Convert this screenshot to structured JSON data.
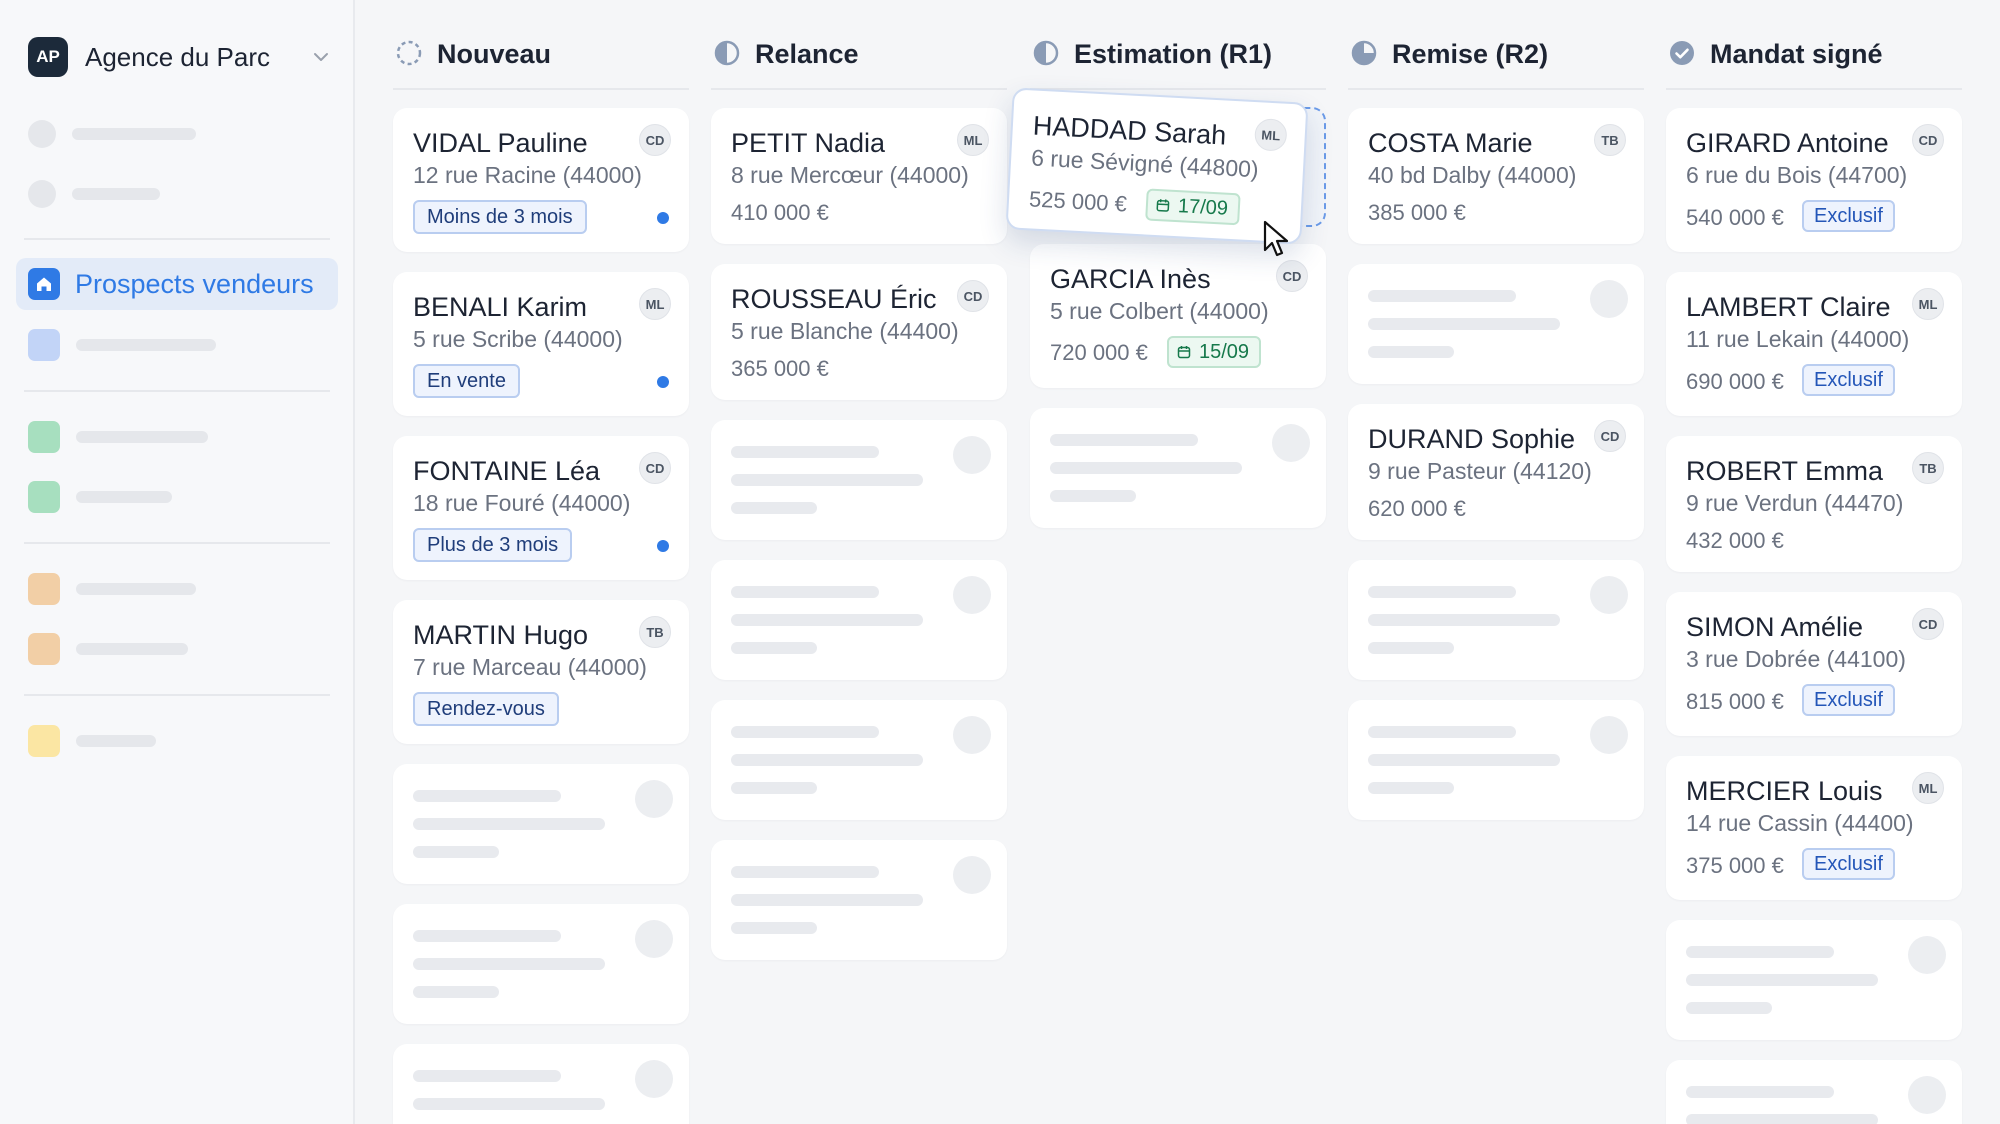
{
  "sidebar": {
    "org": {
      "initials": "AP",
      "name": "Agence du Parc"
    },
    "active_item": "Prospects vendeurs",
    "colors": {
      "active_bg": "#e3ebf8",
      "active_fg": "#2f7ae5"
    }
  },
  "columns": [
    {
      "id": "nouveau",
      "title": "Nouveau",
      "status_icon": "dashed-circle-icon",
      "cards": [
        {
          "name": "VIDAL Pauline",
          "address": "12 rue Racine (44000)",
          "agent": "CD",
          "tag": "Moins de 3 mois",
          "unread": true
        },
        {
          "name": "BENALI Karim",
          "address": "5 rue Scribe (44000)",
          "agent": "ML",
          "tag": "En vente",
          "unread": true
        },
        {
          "name": "FONTAINE Léa",
          "address": "18 rue Fouré (44000)",
          "agent": "CD",
          "tag": "Plus de 3 mois",
          "unread": true
        },
        {
          "name": "MARTIN Hugo",
          "address": "7 rue Marceau (44000)",
          "agent": "TB",
          "tag": "Rendez-vous",
          "unread": false
        }
      ]
    },
    {
      "id": "relance",
      "title": "Relance",
      "status_icon": "quarter-pie-icon",
      "cards": [
        {
          "name": "PETIT Nadia",
          "address": "8 rue Mercœur (44000)",
          "agent": "ML",
          "price": "410 000 €"
        },
        {
          "name": "ROUSSEAU Éric",
          "address": "5 rue Blanche (44400)",
          "agent": "CD",
          "price": "365 000 €"
        }
      ]
    },
    {
      "id": "estimation",
      "title": "Estimation (R1)",
      "status_icon": "half-pie-icon",
      "dragging_card": {
        "name": "HADDAD Sarah",
        "address": "6 rue Sévigné (44800)",
        "agent": "ML",
        "price": "525 000 €",
        "date": "17/09"
      },
      "cards": [
        {
          "name": "GARCIA Inès",
          "address": "5 rue Colbert (44000)",
          "agent": "CD",
          "price": "720 000 €",
          "date": "15/09"
        }
      ]
    },
    {
      "id": "remise",
      "title": "Remise (R2)",
      "status_icon": "three-quarter-pie-icon",
      "cards": [
        {
          "name": "COSTA Marie",
          "address": "40 bd Dalby (44000)",
          "agent": "TB",
          "price": "385 000 €"
        },
        {
          "name": "DURAND Sophie",
          "address": "9 rue Pasteur (44120)",
          "agent": "CD",
          "price": "620 000 €"
        }
      ]
    },
    {
      "id": "mandat",
      "title": "Mandat signé",
      "status_icon": "check-circle-icon",
      "cards": [
        {
          "name": "GIRARD Antoine",
          "address": "6 rue du Bois (44700)",
          "agent": "CD",
          "price": "540 000 €",
          "tag": "Exclusif"
        },
        {
          "name": "LAMBERT Claire",
          "address": "11 rue Lekain (44000)",
          "agent": "ML",
          "price": "690 000 €",
          "tag": "Exclusif"
        },
        {
          "name": "ROBERT Emma",
          "address": "9 rue Verdun (44470)",
          "agent": "TB",
          "price": "432 000 €"
        },
        {
          "name": "SIMON Amélie",
          "address": "3 rue Dobrée (44100)",
          "agent": "CD",
          "price": "815 000 €",
          "tag": "Exclusif"
        },
        {
          "name": "MERCIER Louis",
          "address": "14 rue Cassin (44400)",
          "agent": "ML",
          "price": "375 000 €",
          "tag": "Exclusif"
        }
      ]
    }
  ],
  "colors": {
    "background": "#f5f6f8",
    "card": "#ffffff",
    "accent": "#2f7ae5",
    "date_green": "#16794b",
    "status_icon": "#8a9bb5"
  }
}
